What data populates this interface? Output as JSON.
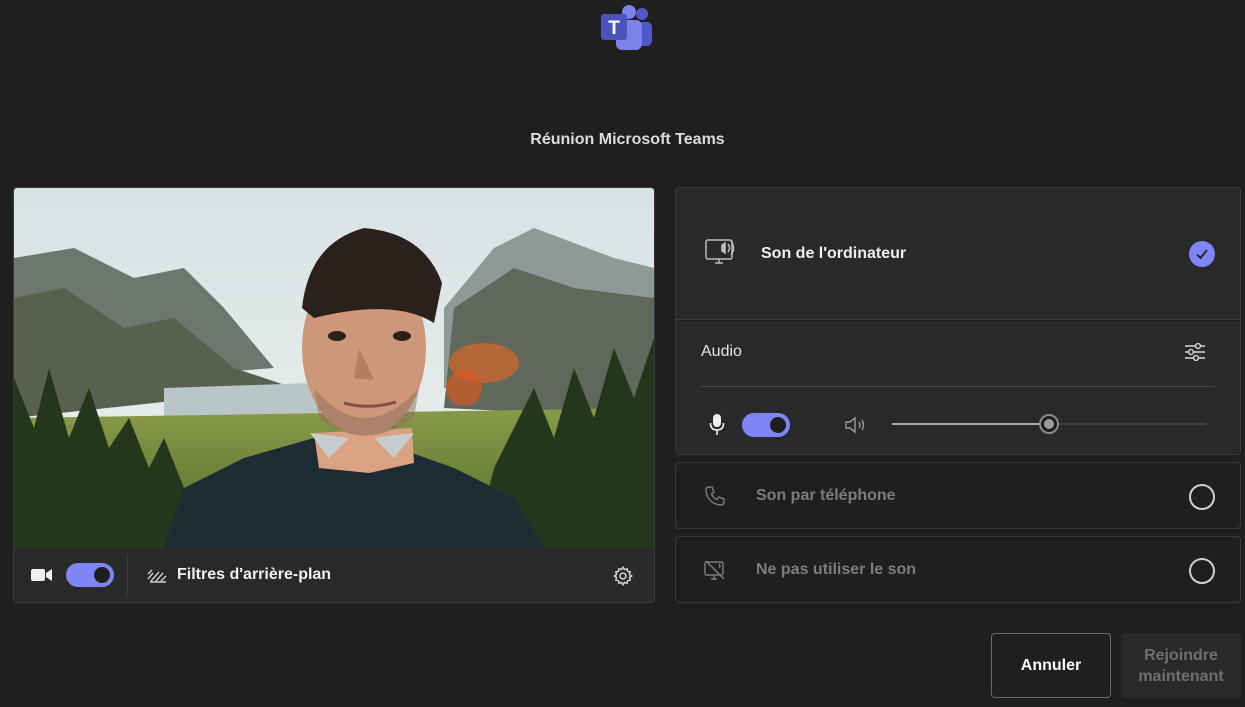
{
  "app": {
    "logo_icon": "microsoft-teams-logo",
    "brand_color": "#7f85f5"
  },
  "meeting": {
    "title": "Réunion Microsoft Teams"
  },
  "video": {
    "camera_icon": "video-camera-icon",
    "camera_on": true,
    "background_filters_label": "Filtres d'arrière-plan",
    "settings_icon": "gear-icon"
  },
  "audio_options": {
    "computer_audio": {
      "label": "Son de l'ordinateur",
      "selected": true
    },
    "audio_section": {
      "label": "Audio",
      "mic_on": true,
      "speaker_volume": 0.5
    },
    "phone_audio": {
      "label": "Son par téléphone",
      "selected": false
    },
    "no_audio": {
      "label": "Ne pas utiliser le son",
      "selected": false
    }
  },
  "actions": {
    "cancel_label": "Annuler",
    "join_label_line1": "Rejoindre",
    "join_label_line2": "maintenant"
  }
}
